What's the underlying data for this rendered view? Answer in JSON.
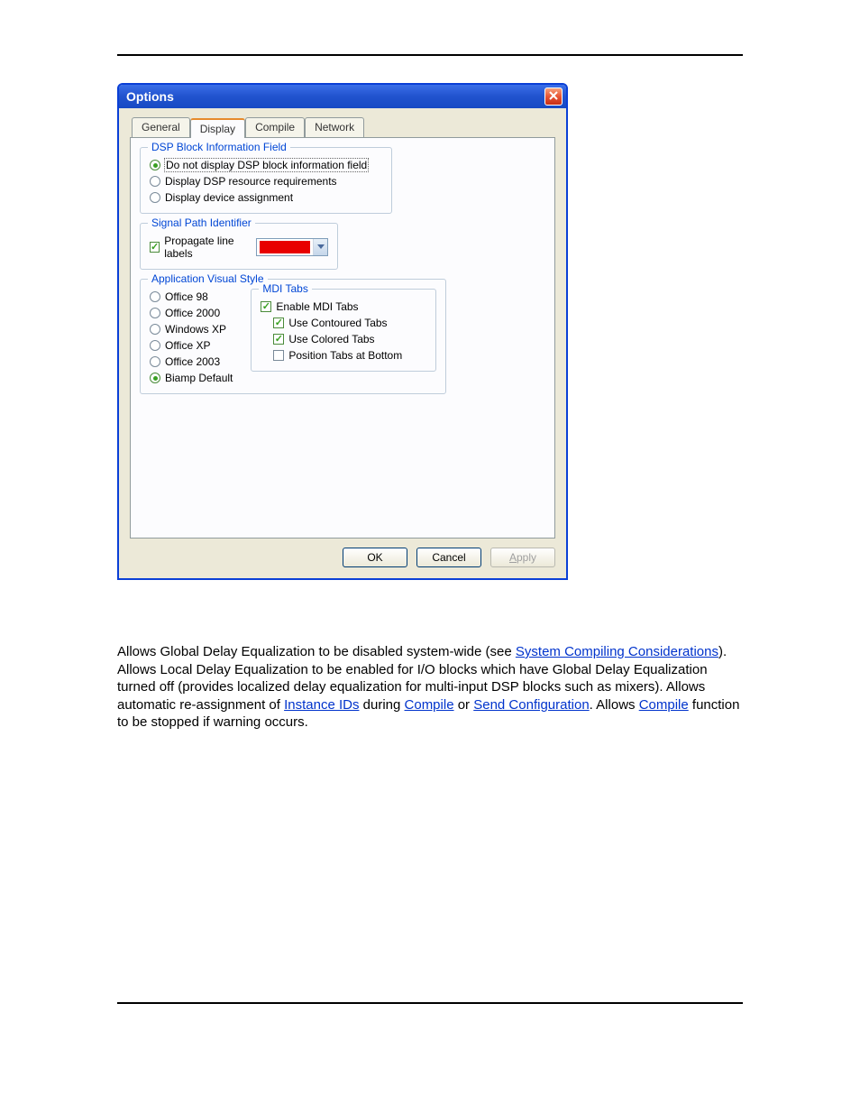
{
  "dialog": {
    "title": "Options",
    "tabs": [
      "General",
      "Display",
      "Compile",
      "Network"
    ],
    "active_tab": "Display",
    "dsp_block_info": {
      "legend": "DSP Block Information Field",
      "options": [
        "Do not display DSP block information field",
        "Display DSP resource requirements",
        "Display device assignment"
      ],
      "selected_index": 0
    },
    "signal_path": {
      "legend": "Signal Path Identifier",
      "propagate_label": "Propagate line labels",
      "propagate_checked": true,
      "color": "#e80000"
    },
    "visual_style": {
      "legend": "Application Visual Style",
      "options": [
        "Office 98",
        "Office 2000",
        "Windows XP",
        "Office XP",
        "Office 2003",
        "Biamp Default"
      ],
      "selected_index": 5
    },
    "mdi_tabs": {
      "legend": "MDI Tabs",
      "items": [
        {
          "label": "Enable MDI Tabs",
          "checked": true
        },
        {
          "label": "Use Contoured Tabs",
          "checked": true
        },
        {
          "label": "Use Colored Tabs",
          "checked": true
        },
        {
          "label": "Position Tabs at Bottom",
          "checked": false
        }
      ]
    },
    "buttons": {
      "ok": "OK",
      "cancel": "Cancel",
      "apply": "Apply"
    }
  },
  "paragraph": {
    "t1": "Allows Global Delay Equalization to be disabled system-wide (see ",
    "link1": "System Compiling Considerations",
    "t2": "). Allows Local Delay Equalization to be enabled for I/O blocks which have Global Delay Equalization turned off (provides localized delay equalization for multi-input DSP blocks such as mixers). Allows automatic re-assignment of ",
    "link2": "Instance IDs",
    "t3": " during ",
    "link3": "Compile",
    "t4": " or ",
    "link4": "Send Configuration",
    "t5": ". Allows ",
    "link5": "Compile",
    "t6": " function to be stopped if warning occurs."
  }
}
